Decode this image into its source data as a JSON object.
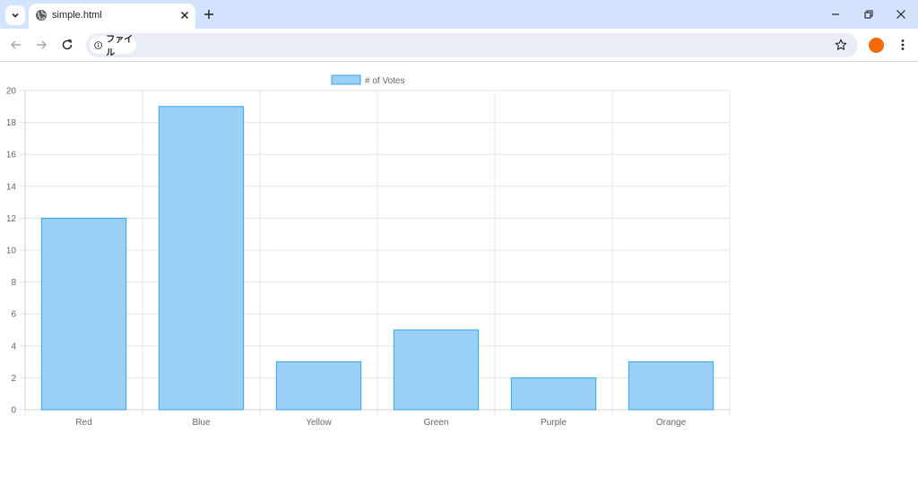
{
  "browser": {
    "tab_title": "simple.html",
    "address_chip_label": "ファイル",
    "profile_color": "#f26b0a"
  },
  "chart_data": {
    "type": "bar",
    "categories": [
      "Red",
      "Blue",
      "Yellow",
      "Green",
      "Purple",
      "Orange"
    ],
    "series": [
      {
        "name": "# of Votes",
        "values": [
          12,
          19,
          3,
          5,
          2,
          3
        ]
      }
    ],
    "ylim": [
      0,
      20
    ],
    "yticks": [
      0,
      2,
      4,
      6,
      8,
      10,
      12,
      14,
      16,
      18,
      20
    ],
    "grid": true,
    "legend_position": "top",
    "bar_fill": "#9ad0f5",
    "bar_stroke": "#36a2eb"
  }
}
